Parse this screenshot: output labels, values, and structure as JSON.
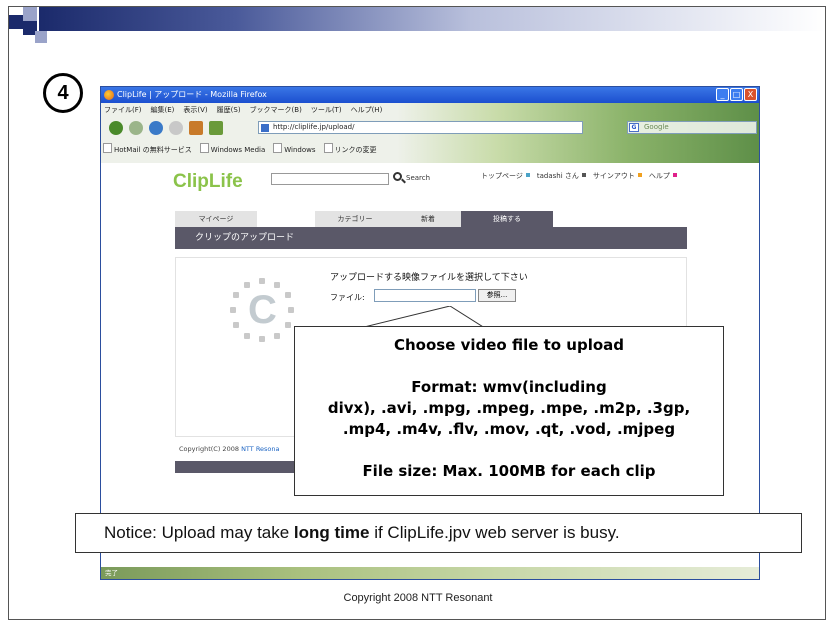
{
  "step_number": "4",
  "window": {
    "title": "ClipLife | アップロード - Mozilla Firefox",
    "controls": [
      "_",
      "□",
      "X"
    ]
  },
  "menu": [
    "ファイル(F)",
    "編集(E)",
    "表示(V)",
    "履歴(S)",
    "ブックマーク(B)",
    "ツール(T)",
    "ヘルプ(H)"
  ],
  "url": "http://cliplife.jp/upload/",
  "search_engine_placeholder": "Google",
  "bookmarks": [
    "HotMail の無料サービス",
    "Windows Media",
    "Windows",
    "リンクの変更"
  ],
  "site": {
    "logo": "ClipLife",
    "search_label": "Search",
    "top_links": [
      "トップページ",
      "tadashi さん",
      "サインアウト",
      "ヘルプ"
    ],
    "tabs": [
      "マイページ",
      "カテゴリー",
      "新着",
      "投稿する"
    ],
    "section_title": "クリップのアップロード",
    "prompt": "アップロードする映像ファイルを選択して下さい",
    "file_label": "ファイル:",
    "browse_button": "参照...",
    "copyright": "Copyright(C) 2008",
    "copyright_link": "NTT Resona"
  },
  "status": "完了",
  "callout": {
    "line1": "Choose video file to upload",
    "line2": "Format: wmv(including",
    "line3": "divx), .avi, .mpg, .mpeg, .mpe, .m2p, .3gp,",
    "line4": ".mp4, .m4v, .flv, .mov, .qt, .vod, .mjpeg",
    "line5": "File size: Max. 100MB for each clip"
  },
  "notice": {
    "before": "Notice: Upload may take ",
    "bold": "long time",
    "after": " if ClipLife.jpv web server is busy."
  },
  "footer": "Copyright 2008 NTT Resonant",
  "colors": {
    "accent_dark": "#5a5868",
    "logo_blue": "#4ba3c7",
    "link_blue": "#1a63c3",
    "slide_navy": "#1b2a6b"
  }
}
